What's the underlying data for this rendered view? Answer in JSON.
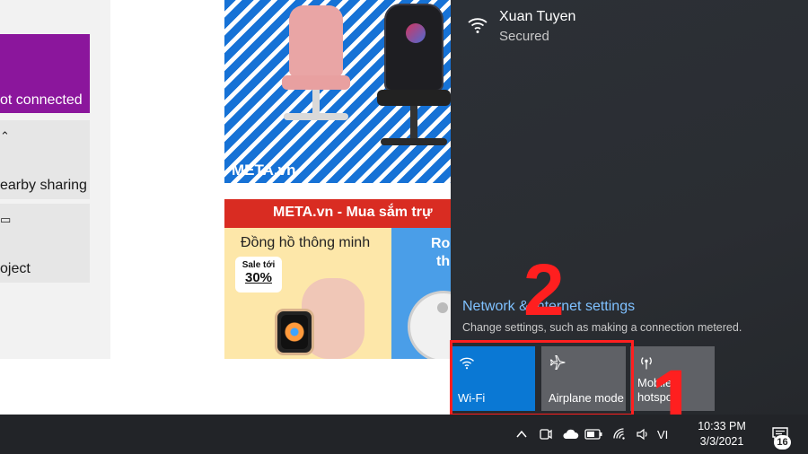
{
  "settings_tiles": {
    "network_label": "ot connected",
    "nearby_label": "earby sharing",
    "project_label": "oject"
  },
  "ads": {
    "top_logo": "META.vn",
    "banner_text": "META.vn - Mua sắm trự",
    "watch_title": "Đồng hồ thông minh",
    "sale_line1": "Sale tới",
    "sale_line2": "30%",
    "blue_title_1": "Ro",
    "blue_title_2": "th"
  },
  "action_center": {
    "wifi_name": "Xuan Tuyen",
    "wifi_status": "Secured",
    "network_settings_link": "Network & Internet settings",
    "network_settings_sub": "Change settings, such as making a connection metered.",
    "quick_actions": [
      {
        "label": "Wi-Fi",
        "icon": "wifi-icon",
        "state": "on"
      },
      {
        "label": "Airplane mode",
        "icon": "airplane-icon",
        "state": "off"
      },
      {
        "label": "Mobile hotspot",
        "icon": "hotspot-icon",
        "state": "off"
      }
    ]
  },
  "annotations": {
    "step1": "1",
    "step2": "2",
    "color": "#ff1f1f"
  },
  "taskbar": {
    "language": "VI",
    "time": "10:33 PM",
    "date": "3/3/2021",
    "notification_count": "16"
  },
  "colors": {
    "accent": "#0a78d4",
    "action_center_bg": "#2a2d32",
    "taskbar_bg": "#222428",
    "link": "#7fc1ff"
  }
}
